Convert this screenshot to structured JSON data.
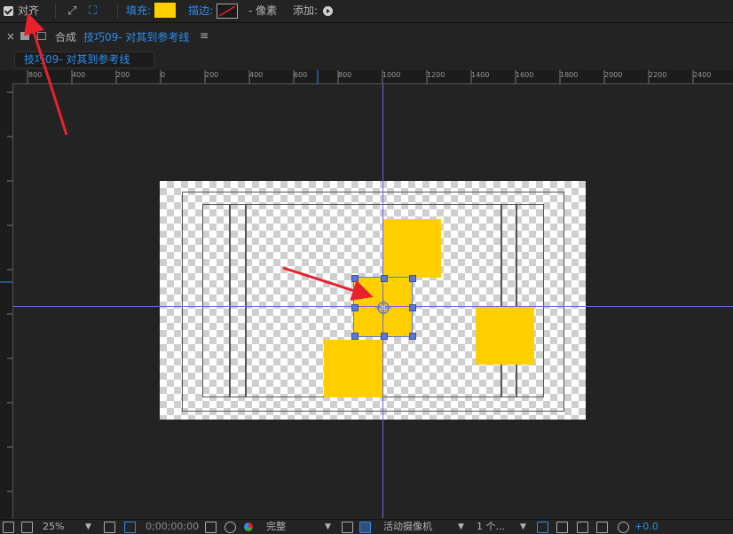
{
  "toolbar": {
    "align_label": "对齐",
    "fill_label": "填充:",
    "fill_color": "#ffcf00",
    "stroke_label": "描边:",
    "pixels_label": "- 像素",
    "add_label": "添加:"
  },
  "panel": {
    "close": "×",
    "comp_prefix": "合成",
    "comp_name": "技巧09- 对其到参考线",
    "menu": "≡",
    "tab_label": "技巧09- 对其到参考线"
  },
  "ruler": {
    "labels": [
      "800",
      "400",
      "200",
      "0",
      "200",
      "400",
      "600",
      "800",
      "1000",
      "1200",
      "1400",
      "1600",
      "1800",
      "2000",
      "2200",
      "2400"
    ]
  },
  "bottom": {
    "zoom": "25%",
    "timecode": "0;00;00;00",
    "resolution": "完整",
    "camera": "活动摄像机",
    "views": "1 个...",
    "exposure": "+0.0"
  },
  "colors": {
    "accent": "#2d8ceb",
    "shape": "#ffcf00",
    "guide": "#6a6ad2",
    "annotation": "#e8212b"
  }
}
